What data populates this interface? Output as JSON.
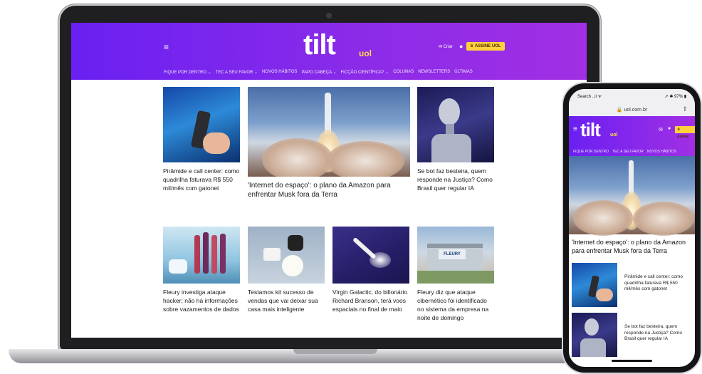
{
  "site": {
    "logo": "tilt",
    "logo_sub": "uol",
    "mail_label": "✉ Criar",
    "subscribe_label": "♛ ASSINE UOL",
    "nav": [
      "FIQUE POR DENTRO ⌄",
      "TEC A SEU FAVOR ⌄",
      "NOVOS HÁBITOS",
      "PAPO CABEÇA ⌄",
      "FICÇÃO CIENTÍFICA? ⌄",
      "COLUNAS",
      "NEWSLETTERS",
      "ÚLTIMAS"
    ]
  },
  "laptop": {
    "articles_top": [
      {
        "title": "Pirâmide e call center: como quadrilha faturava R$ 550 mil/mês com gatonet"
      },
      {
        "title": "'Internet do espaço': o plano da Amazon para enfrentar Musk fora da Terra"
      },
      {
        "title": "Se bot faz besteira, quem responde na Justiça? Como Brasil quer regular IA"
      }
    ],
    "articles_bottom": [
      {
        "title": "Fleury investiga ataque hacker; não há informações sobre vazamentos de dados"
      },
      {
        "title": "Testamos kit sucesso de vendas que vai deixar sua casa mais inteligente"
      },
      {
        "title": "Virgin Galactic, do bilionário Richard Branson, terá voos espaciais no final de maio"
      },
      {
        "title": "Fleury diz que ataque cibernético foi identificado no sistema da empresa na noite de domingo"
      }
    ],
    "fleury_sign": "FLEURY"
  },
  "phone": {
    "status_left": "Search ..ıl ᯤ",
    "status_right": "➚ ✱ 97% ▮",
    "url": "🔒 uol.com.br",
    "share_icon": "⇧",
    "mail_label": "✉",
    "subscribe_label": "♛ Assine",
    "nav": [
      "FIQUE POR DENTRO",
      "TEC A SEU FAVOR",
      "NOVOS HÁBITOS"
    ],
    "hero_title": "'Internet do espaço': o plano da Amazon para enfrentar Musk fora da Terra",
    "items": [
      {
        "title": "Pirâmide e call center: como quadrilha faturava R$ 550 mil/mês com gatonet"
      },
      {
        "title": "Se bot faz besteira, quem responde na Justiça? Como Brasil quer regular IA"
      }
    ]
  }
}
